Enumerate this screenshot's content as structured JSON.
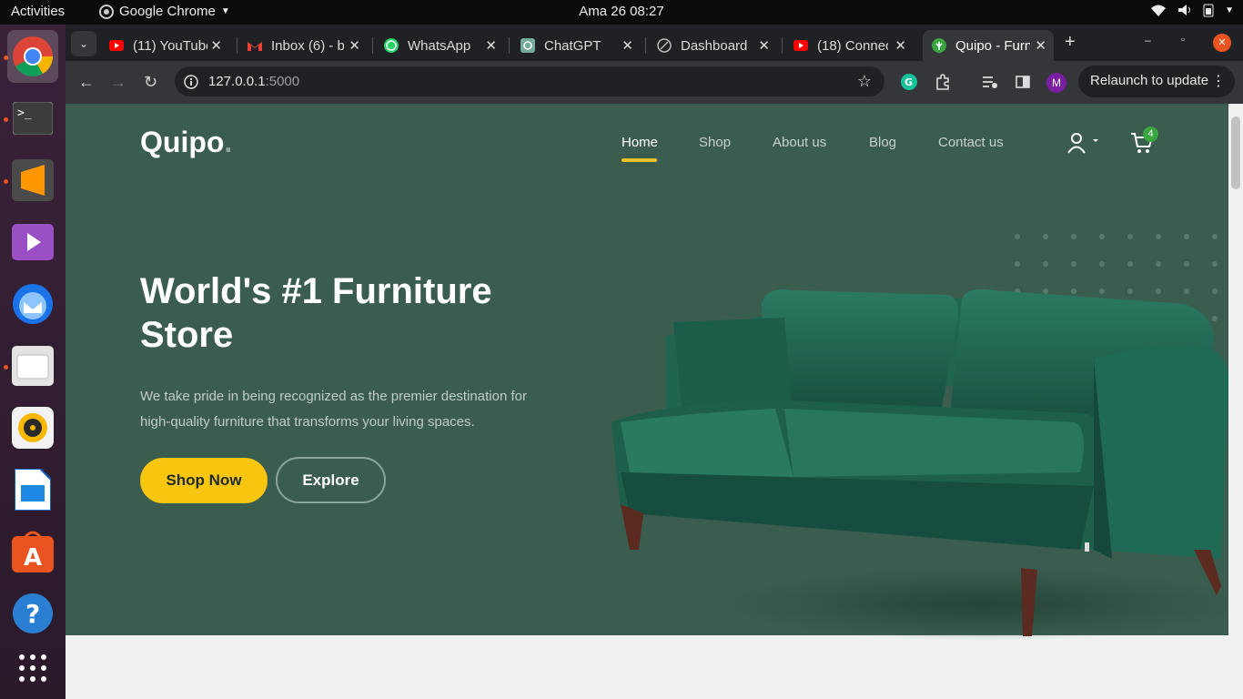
{
  "topbar": {
    "activities": "Activities",
    "app_name": "Google Chrome",
    "clock": "Ama 26  08:27"
  },
  "dock": {
    "items": [
      "chrome-icon",
      "terminal-icon",
      "sublime-text-icon",
      "media-player-icon",
      "thunderbird-icon",
      "files-icon",
      "rhythmbox-icon",
      "libreoffice-impress-icon",
      "app-center-icon",
      "help-icon",
      "show-apps-icon"
    ]
  },
  "tabs": [
    {
      "title": "(11) YouTube",
      "icon": "youtube-icon"
    },
    {
      "title": "Inbox (6) - b",
      "icon": "gmail-icon"
    },
    {
      "title": "WhatsApp",
      "icon": "whatsapp-icon"
    },
    {
      "title": "ChatGPT",
      "icon": "chatgpt-icon"
    },
    {
      "title": "Dashboard",
      "icon": "dashboard-icon"
    },
    {
      "title": "(18) Connec",
      "icon": "youtube-icon"
    },
    {
      "title": "Quipo - Furn",
      "icon": "quipo-icon",
      "active": true
    }
  ],
  "toolbar": {
    "url_host": "127.0.0.1",
    "url_port": ":5000",
    "profile_initial": "M",
    "relaunch_label": "Relaunch to update"
  },
  "site": {
    "logo": "Quipo",
    "logo_dot": ".",
    "nav": [
      "Home",
      "Shop",
      "About us",
      "Blog",
      "Contact us"
    ],
    "cart_count": "4",
    "headline": "World's #1 Furniture Store",
    "subtext": "We take pride in being recognized as the premier destination for high-quality furniture that transforms your living spaces.",
    "primary_button": "Shop Now",
    "secondary_button": "Explore"
  },
  "colors": {
    "hero_bg": "#3b5d50",
    "accent_yellow": "#f9bf29",
    "sofa_green": "#1f5b4a"
  }
}
